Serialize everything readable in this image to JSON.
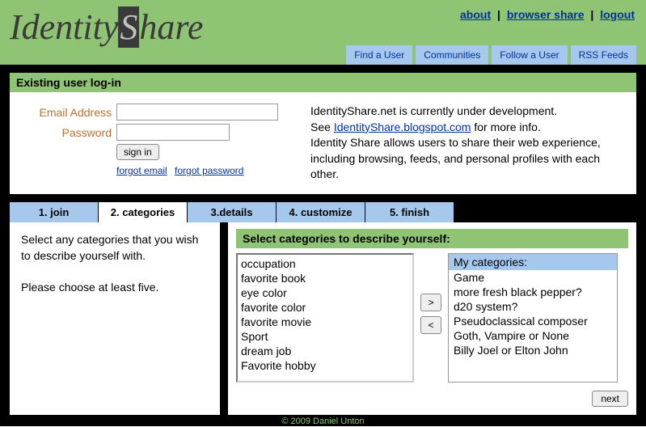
{
  "logo": {
    "part1": "Identity",
    "part2": "S",
    "part3": "hare"
  },
  "topLinks": {
    "about": "about",
    "browserShare": "browser share",
    "logout": "logout"
  },
  "nav": {
    "findUser": "Find a User",
    "communities": "Communities",
    "followUser": "Follow a User",
    "rssFeeds": "RSS Feeds"
  },
  "login": {
    "title": "Existing user log-in",
    "emailLabel": "Email Address",
    "passwordLabel": "Password",
    "signin": "sign in",
    "forgotEmail": "forgot email",
    "forgotPassword": "forgot password",
    "infoLine1": "IdentityShare.net is currently under development.",
    "infoSee": "See ",
    "infoLink": "IdentityShare.blogspot.com",
    "infoAfterLink": " for more info.",
    "infoLine2": "Identity Share allows users to share their web experience, including browsing, feeds, and personal profiles with each other."
  },
  "wizard": {
    "tabs": {
      "t1": "1. join",
      "t2": "2. categories",
      "t3": "3.details",
      "t4": "4. customize",
      "t5": "5. finish"
    },
    "leftText1": "Select any categories that you wish to describe yourself with.",
    "leftText2": "Please choose at least five.",
    "selectTitle": "Select categories to describe yourself:",
    "available": [
      "occupation",
      "favorite book",
      "eye color",
      "favorite color",
      "favorite movie",
      "Sport",
      "dream job",
      "Favorite hobby"
    ],
    "myTitle": "My categories:",
    "mine": [
      "Game",
      "more fresh black pepper?",
      "d20 system?",
      "Pseudoclassical composer",
      "Goth, Vampire or None",
      "Billy Joel or Elton John"
    ],
    "moveRight": ">",
    "moveLeft": "<",
    "next": "next"
  },
  "footer": "© 2009 Daniel Unton"
}
